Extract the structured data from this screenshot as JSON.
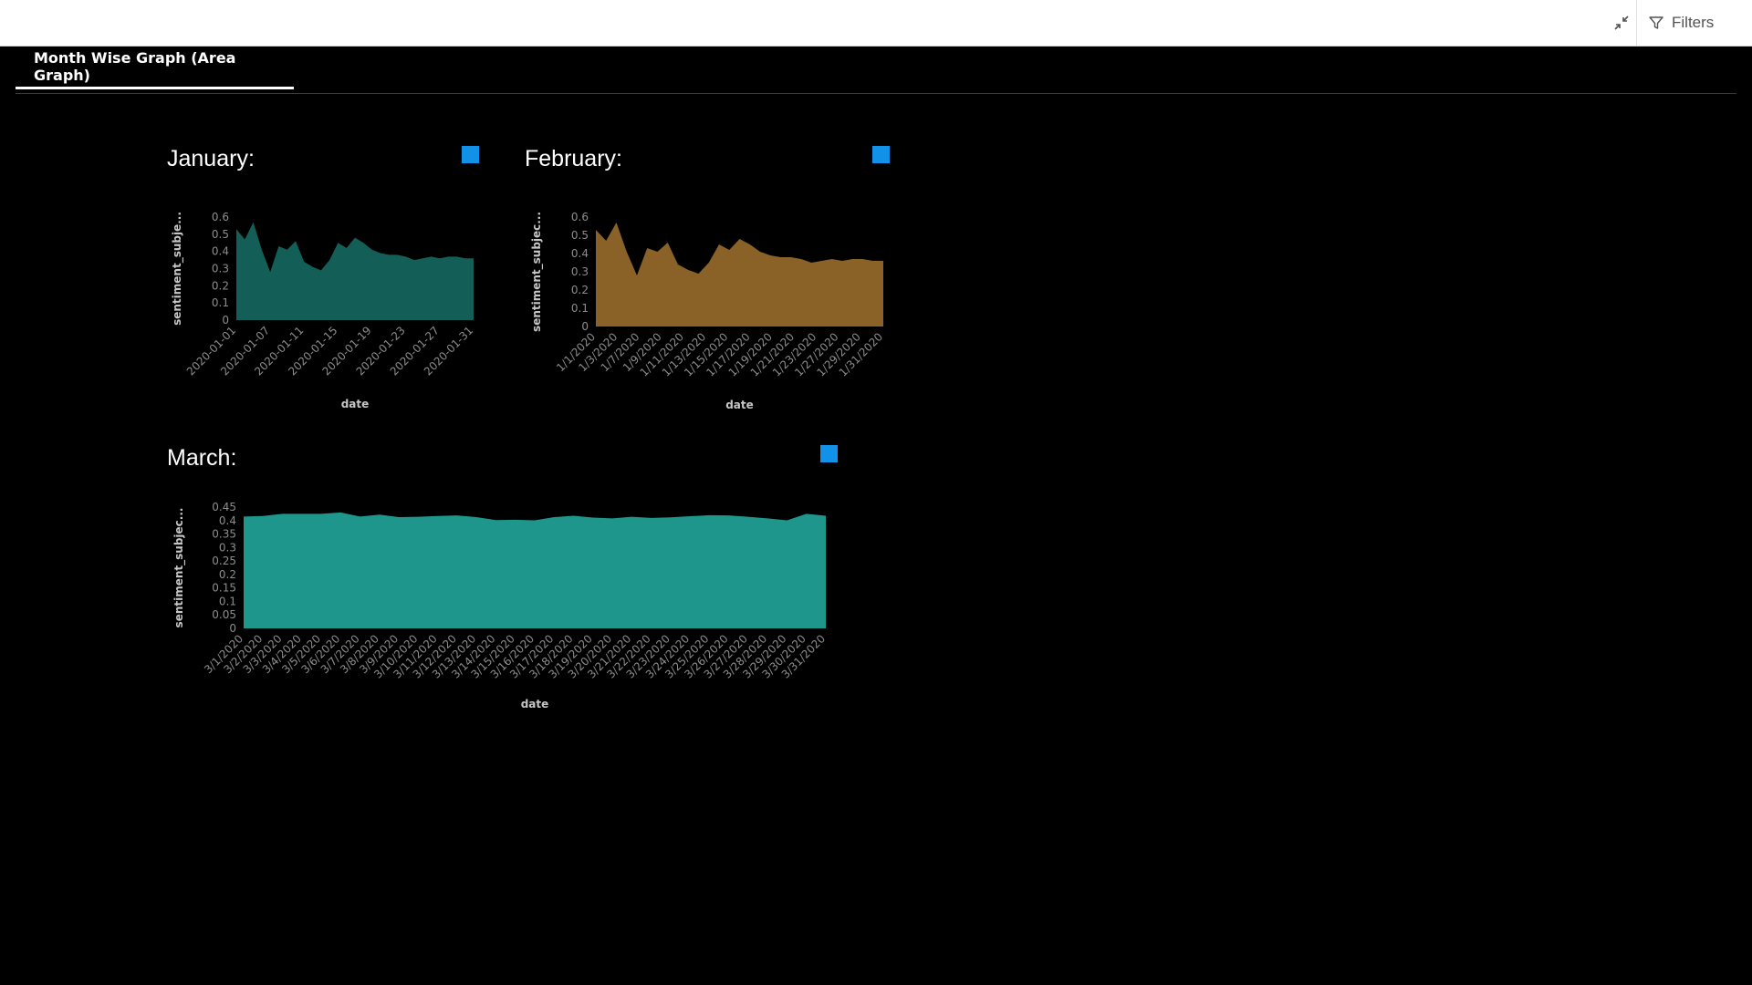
{
  "toolbar": {
    "collapse_icon": "collapse-arrows-icon",
    "filter_icon": "filter-funnel-icon",
    "filters_label": "Filters"
  },
  "tabs": [
    {
      "label": "Month Wise Graph (Area Graph)",
      "active": true
    }
  ],
  "colors": {
    "legend": "#1192e8",
    "january": "#135e57",
    "february": "#8a6228",
    "march": "#1f968b"
  },
  "chart_data": [
    {
      "type": "area",
      "panel_title": "January:",
      "xlabel": "date",
      "ylabel": "sentiment_subje...",
      "ylim": [
        0,
        0.6
      ],
      "yticks": [
        "0",
        "0.1",
        "0.2",
        "0.3",
        "0.4",
        "0.5",
        "0.6"
      ],
      "xticks": [
        "2020-01-01",
        "2020-01-07",
        "2020-01-11",
        "2020-01-15",
        "2020-01-19",
        "2020-01-23",
        "2020-01-27",
        "2020-01-31"
      ],
      "values": [
        0.53,
        0.47,
        0.57,
        0.41,
        0.28,
        0.43,
        0.41,
        0.46,
        0.34,
        0.31,
        0.29,
        0.35,
        0.45,
        0.42,
        0.48,
        0.45,
        0.41,
        0.39,
        0.38,
        0.38,
        0.37,
        0.35,
        0.36,
        0.37,
        0.36,
        0.37,
        0.37,
        0.36,
        0.36
      ],
      "color": "#135e57"
    },
    {
      "type": "area",
      "panel_title": "February:",
      "xlabel": "date",
      "ylabel": "sentiment_subjec...",
      "ylim": [
        0,
        0.6
      ],
      "yticks": [
        "0",
        "0.1",
        "0.2",
        "0.3",
        "0.4",
        "0.5",
        "0.6"
      ],
      "xticks": [
        "1/1/2020",
        "1/3/2020",
        "1/7/2020",
        "1/9/2020",
        "1/11/2020",
        "1/13/2020",
        "1/15/2020",
        "1/17/2020",
        "1/19/2020",
        "1/21/2020",
        "1/23/2020",
        "1/27/2020",
        "1/29/2020",
        "1/31/2020"
      ],
      "values": [
        0.53,
        0.47,
        0.57,
        0.41,
        0.28,
        0.43,
        0.41,
        0.46,
        0.34,
        0.31,
        0.29,
        0.35,
        0.45,
        0.42,
        0.48,
        0.45,
        0.41,
        0.39,
        0.38,
        0.38,
        0.37,
        0.35,
        0.36,
        0.37,
        0.36,
        0.37,
        0.37,
        0.36,
        0.36
      ],
      "color": "#8a6228"
    },
    {
      "type": "area",
      "panel_title": "March:",
      "xlabel": "date",
      "ylabel": "sentiment_subjec...",
      "ylim": [
        0,
        0.45
      ],
      "yticks": [
        "0",
        "0.05",
        "0.1",
        "0.15",
        "0.2",
        "0.25",
        "0.3",
        "0.35",
        "0.4",
        "0.45"
      ],
      "xticks": [
        "3/1/2020",
        "3/2/2020",
        "3/3/2020",
        "3/4/2020",
        "3/5/2020",
        "3/6/2020",
        "3/7/2020",
        "3/8/2020",
        "3/9/2020",
        "3/10/2020",
        "3/11/2020",
        "3/12/2020",
        "3/13/2020",
        "3/14/2020",
        "3/15/2020",
        "3/16/2020",
        "3/17/2020",
        "3/18/2020",
        "3/19/2020",
        "3/20/2020",
        "3/21/2020",
        "3/22/2020",
        "3/23/2020",
        "3/24/2020",
        "3/25/2020",
        "3/26/2020",
        "3/27/2020",
        "3/28/2020",
        "3/29/2020",
        "3/30/2020",
        "3/31/2020"
      ],
      "values": [
        0.415,
        0.417,
        0.425,
        0.425,
        0.425,
        0.43,
        0.415,
        0.422,
        0.413,
        0.414,
        0.417,
        0.419,
        0.413,
        0.402,
        0.403,
        0.401,
        0.413,
        0.418,
        0.411,
        0.408,
        0.414,
        0.41,
        0.412,
        0.416,
        0.42,
        0.419,
        0.414,
        0.408,
        0.401,
        0.425,
        0.418
      ],
      "color": "#1f968b"
    }
  ]
}
